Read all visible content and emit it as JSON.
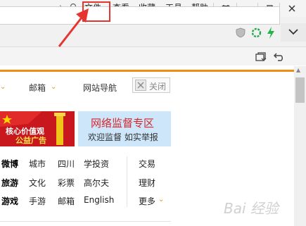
{
  "menubar": {
    "items": [
      "文件",
      "查看",
      "收藏",
      "工具",
      "帮助"
    ]
  },
  "page": {
    "nav": {
      "mail": "邮箱",
      "site_nav": "网站导航",
      "close": "关闭"
    },
    "banners": {
      "red_line1": "核心价值观",
      "red_line2": "公益广告",
      "blue_title": "网络监督专区",
      "blue_subtitle": "欢迎监督 如实举报"
    },
    "links": {
      "row1": [
        "微博",
        "城市",
        "四川",
        "学投资",
        "交易"
      ],
      "row2": [
        "旅游",
        "文化",
        "彩票",
        "高尔夫",
        "理财"
      ],
      "row3": [
        "游戏",
        "手游",
        "邮箱",
        "English",
        "更多"
      ]
    },
    "watermark": "Bai 经验"
  },
  "colors": {
    "accent_orange": "#f58a13",
    "annotation_red": "#e8342f",
    "banner_red": "#c8171d",
    "banner_blue": "#cde6fa",
    "banner_blue_text": "#d4262b"
  },
  "icons": [
    "chevron-right-icon",
    "user-icon",
    "shirt-icon",
    "minimize-icon",
    "restore-icon",
    "close-icon",
    "shield-icon",
    "refresh-icon",
    "lightning-icon",
    "chevron-down-icon",
    "tabs-icon",
    "undo-icon",
    "close-x-icon"
  ]
}
